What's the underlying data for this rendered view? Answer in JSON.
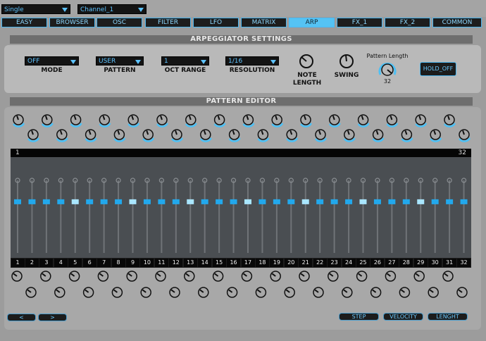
{
  "top": {
    "mode_select": "Single",
    "channel_select": "Channel_1"
  },
  "tabs": [
    "EASY",
    "BROWSER",
    "OSC",
    "FILTER",
    "LFO",
    "MATRIX",
    "ARP",
    "FX_1",
    "FX_2",
    "COMMON"
  ],
  "active_tab": "ARP",
  "arp": {
    "title": "ARPEGGIATOR SETTINGS",
    "mode_value": "OFF",
    "mode_label": "MODE",
    "pattern_value": "USER",
    "pattern_label": "PATTERN",
    "oct_value": "1",
    "oct_label": "OCT RANGE",
    "res_value": "1/16",
    "res_label": "RESOLUTION",
    "note_length_label_1": "NOTE",
    "note_length_label_2": "LENGTH",
    "swing_label": "SWING",
    "pattern_length_label": "Pattern Length",
    "pattern_length_value": "32",
    "hold_label": "HOLD_OFF"
  },
  "editor": {
    "title": "PATTERN EDITOR",
    "range_start": "1",
    "range_end": "32",
    "steps": [
      "1",
      "2",
      "3",
      "4",
      "5",
      "6",
      "7",
      "8",
      "9",
      "10",
      "11",
      "12",
      "13",
      "14",
      "15",
      "16",
      "17",
      "18",
      "19",
      "20",
      "21",
      "22",
      "23",
      "24",
      "25",
      "26",
      "27",
      "28",
      "29",
      "30",
      "31",
      "32"
    ],
    "step_levels": [
      0.71,
      0.71,
      0.71,
      0.71,
      0.71,
      0.71,
      0.71,
      0.71,
      0.71,
      0.71,
      0.71,
      0.71,
      0.71,
      0.71,
      0.71,
      0.71,
      0.71,
      0.71,
      0.71,
      0.71,
      0.71,
      0.71,
      0.71,
      0.71,
      0.71,
      0.71,
      0.71,
      0.71,
      0.71,
      0.71,
      0.71,
      0.71
    ],
    "accent_steps": [
      5,
      9,
      13,
      17,
      21,
      25,
      29
    ],
    "prev_label": "<",
    "next_label": ">",
    "step_btn": "STEP",
    "velocity_btn": "VELOCITY",
    "length_btn": "LENGHT"
  },
  "colors": {
    "accent": "#4cc0f5",
    "dark": "#141414",
    "panel": "#b9b9b9"
  }
}
